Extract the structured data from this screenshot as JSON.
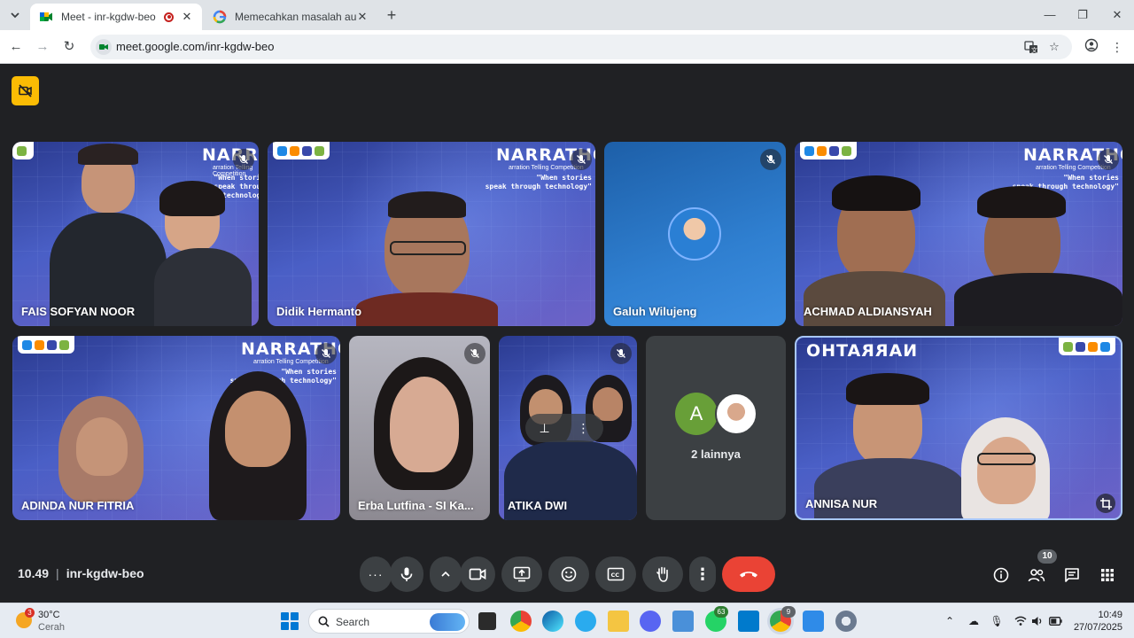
{
  "browser": {
    "tabs": [
      {
        "title": "Meet - inr-kgdw-beo",
        "icon": "google-meet-icon",
        "recording": true
      },
      {
        "title": "Memecahkan masalah audio d",
        "icon": "google-icon"
      }
    ],
    "url": "meet.google.com/inr-kgdw-beo",
    "new_tab_symbol": "+"
  },
  "meeting": {
    "time": "10.49",
    "code": "inr-kgdw-beo",
    "participant_count": "10",
    "brand": "NARRATHO",
    "brand_sub": "arration Telling Competition",
    "slogan_1": "\"When stories",
    "slogan_2": "speak through technology\"",
    "participants": [
      {
        "name": "FAIS SOFYAN NOOR",
        "muted": true
      },
      {
        "name": "Didik Hermanto",
        "muted": true
      },
      {
        "name": "Galuh Wilujeng",
        "muted": true
      },
      {
        "name": "ACHMAD ALDIANSYAH",
        "muted": true
      },
      {
        "name": "ADINDA NUR FITRIA",
        "muted": true
      },
      {
        "name": "Erba Lutfina - SI Ka...",
        "muted": true
      },
      {
        "name": "ATIKA DWI",
        "muted": true
      },
      {
        "name": "ANNISA NUR",
        "muted": false
      }
    ],
    "others": {
      "label": "2 lainnya",
      "avatar_letter": "A",
      "avatar_color": "#689f38"
    }
  },
  "taskbar": {
    "weather_temp": "30°C",
    "weather_desc": "Cerah",
    "weather_badge": "3",
    "search_placeholder": "Search",
    "whatsapp_badge": "63",
    "chrome_badge": "9",
    "clock_time": "10:49",
    "clock_date": "27/07/2025"
  },
  "colors": {
    "meet_bg": "#202124",
    "end_call": "#ea4335",
    "control_bg": "#3c4043",
    "badge_yellow": "#fbbc04"
  }
}
